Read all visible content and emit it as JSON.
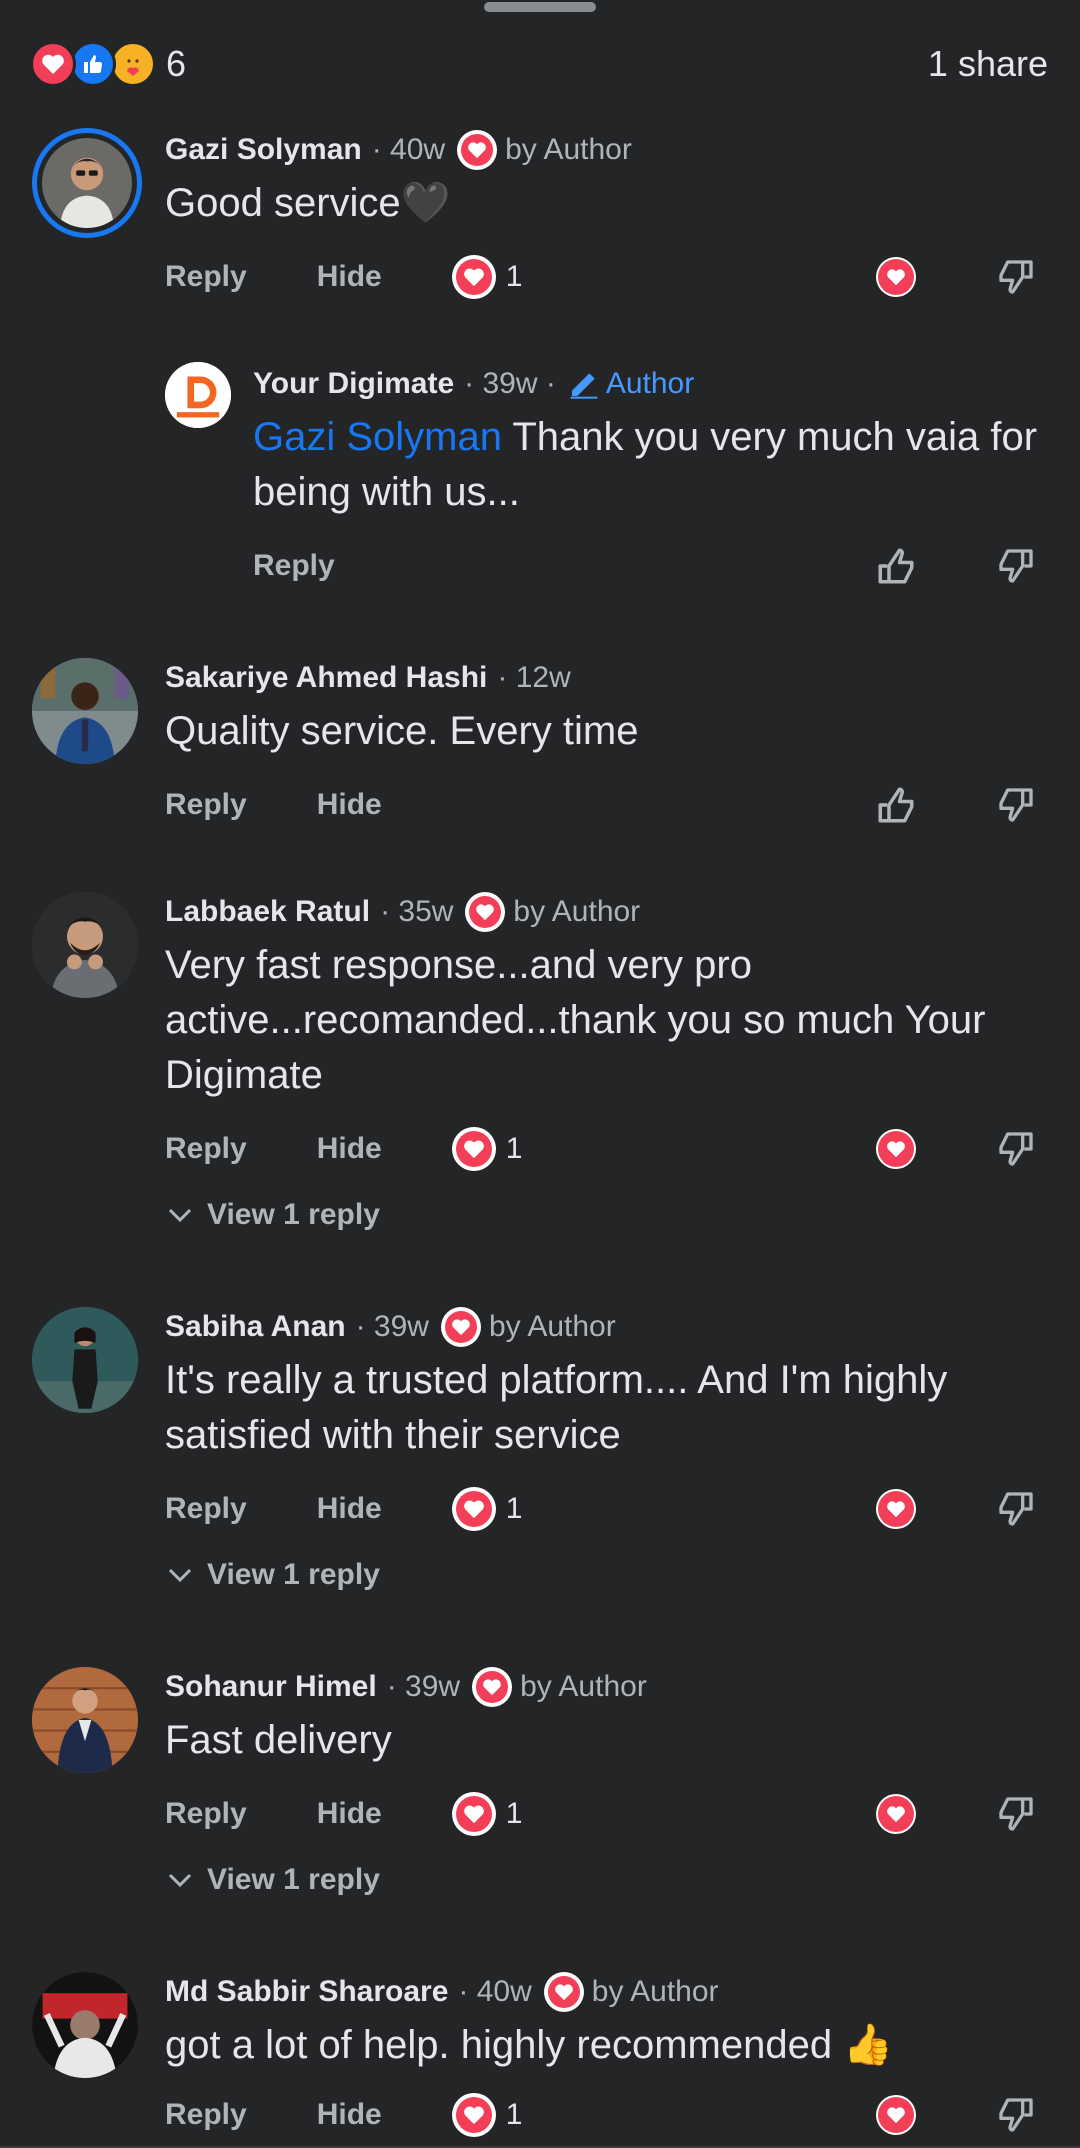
{
  "summary": {
    "reaction_count": "6",
    "share_text": "1 share",
    "reaction_icons": [
      "love-icon",
      "like-icon",
      "care-icon"
    ]
  },
  "labels": {
    "reply": "Reply",
    "hide": "Hide",
    "by_author": "by Author",
    "author": "Author",
    "view_reply": "View 1 reply"
  },
  "comments": [
    {
      "name": "Gazi Solyman",
      "time": "· 40w",
      "text": "Good service🖤",
      "reaction_count": "1"
    },
    {
      "name": "Your Digimate",
      "time": "· 39w ·",
      "mention": "Gazi Solyman",
      "text": "Thank you very much vaia for being with us..."
    },
    {
      "name": "Sakariye Ahmed Hashi",
      "time": "· 12w",
      "text": "Quality service. Every time"
    },
    {
      "name": "Labbaek Ratul",
      "time": "· 35w",
      "text": "Very fast response...and very pro active...recomanded...thank you so much Your Digimate",
      "reaction_count": "1"
    },
    {
      "name": "Sabiha Anan",
      "time": "· 39w",
      "text": "It's really a trusted platform.... And I'm highly satisfied with their service",
      "reaction_count": "1"
    },
    {
      "name": "Sohanur Himel",
      "time": "· 39w",
      "text": "Fast delivery",
      "reaction_count": "1"
    },
    {
      "name": "Md Sabbir Sharoare",
      "time": "· 40w",
      "text": "got a lot of help. highly recommended 👍",
      "reaction_count": "1"
    }
  ],
  "colors": {
    "background": "#242527",
    "love": "#f33e58",
    "like": "#1877f2",
    "link": "#1877f2",
    "author_badge": "#4599ff",
    "secondary_text": "#b0b3b8"
  }
}
